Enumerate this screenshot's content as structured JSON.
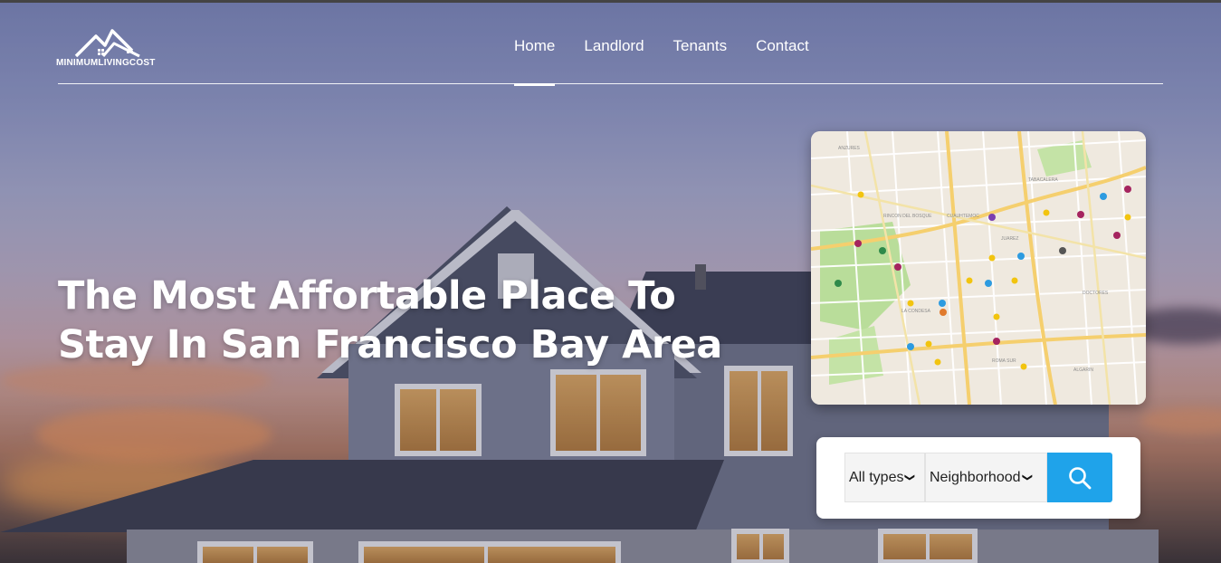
{
  "brand": {
    "logo_text": "MINIMUMLIVINGCOST",
    "logo_icon": "house-roofs-logo"
  },
  "nav": {
    "items": [
      {
        "label": "Home",
        "active": true
      },
      {
        "label": "Landlord",
        "active": false
      },
      {
        "label": "Tenants",
        "active": false
      },
      {
        "label": "Contact",
        "active": false
      }
    ]
  },
  "hero": {
    "headline_line1": "The Most Affortable Place To",
    "headline_line2": "Stay In San Francisco Bay Area"
  },
  "map": {
    "icon": "city-map-preview"
  },
  "search": {
    "type_select": {
      "selected": "All types"
    },
    "neighborhood_select": {
      "selected": "Neighborhood"
    },
    "button_icon": "search-icon"
  },
  "colors": {
    "accent": "#1fa3ea",
    "text_light": "#ffffff",
    "panel_bg": "#ffffff"
  }
}
